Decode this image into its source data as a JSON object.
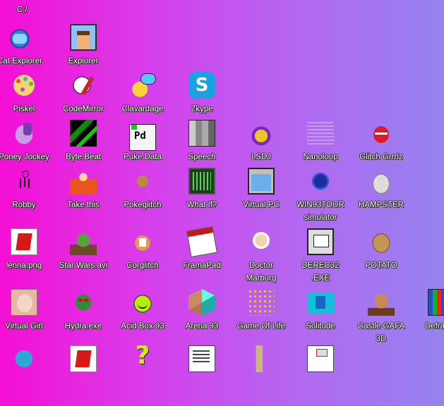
{
  "desktop": {
    "drive_label": "C:/",
    "icons": [
      {
        "label": "Cat Explorer",
        "icon": "cat-icon"
      },
      {
        "label": "Explorer",
        "icon": "explorer-window-icon"
      },
      {
        "label": "Piskel",
        "icon": "paint-palette-icon"
      },
      {
        "label": "CodeMirror",
        "icon": "codemirror-icon"
      },
      {
        "label": "Clavardage",
        "icon": "chat-smiley-icon"
      },
      {
        "label": "Zkype",
        "icon": "skype-icon"
      },
      {
        "label": "Poney Jockey",
        "icon": "pony-icon"
      },
      {
        "label": "Byte Beat",
        "icon": "bytebeat-icon"
      },
      {
        "label": "Puke Data",
        "icon": "puredata-icon"
      },
      {
        "label": "Speech",
        "icon": "speech-face-icon"
      },
      {
        "label": "LSDJ",
        "icon": "gameboy-icon"
      },
      {
        "label": "Nanoloop",
        "icon": "nanoloop-icon"
      },
      {
        "label": "Glitch Grrrlz",
        "icon": "lips-icon"
      },
      {
        "label": "Robby",
        "icon": "stick-figure-icon"
      },
      {
        "label": "Take this",
        "icon": "character-icon"
      },
      {
        "label": "Pokeglitch",
        "icon": "pokeglitch-icon"
      },
      {
        "label": "What If?",
        "icon": "terminal-icon"
      },
      {
        "label": "Virtual PC",
        "icon": "window-cursor-icon"
      },
      {
        "label": "WIN93TOUR\nsimulator",
        "icon": "blue-blob-icon"
      },
      {
        "label": "HAMPSTER",
        "icon": "hamster-icon"
      },
      {
        "label": "lenna.png",
        "icon": "image-file-icon"
      },
      {
        "label": "Star Wars.avi",
        "icon": "yoda-icon"
      },
      {
        "label": "Corglitch",
        "icon": "corgi-icon"
      },
      {
        "label": "FramaPad",
        "icon": "notepad-pencil-icon"
      },
      {
        "label": "Doctor\nMarburg",
        "icon": "doctor-icon"
      },
      {
        "label": "DEREC32\n.EXE",
        "icon": "computer-face-icon"
      },
      {
        "label": "POTATO",
        "icon": "potato-icon"
      },
      {
        "label": "Virtual Girl",
        "icon": "girl-face-icon"
      },
      {
        "label": "Hydra.exe",
        "icon": "dragon-icon"
      },
      {
        "label": "Acid Box 93",
        "icon": "acid-smiley-icon"
      },
      {
        "label": "Arena 93",
        "icon": "cube-icon"
      },
      {
        "label": "Game Of Life",
        "icon": "cells-icon"
      },
      {
        "label": "Solitude",
        "icon": "cards-icon"
      },
      {
        "label": "Castle GAFA\n3D",
        "icon": "doom-guy-icon"
      },
      {
        "label": "Defra",
        "icon": "defrag-icon"
      },
      {
        "label": "",
        "icon": "dolphin-icon"
      },
      {
        "label": "",
        "icon": "image-file-icon"
      },
      {
        "label": "",
        "icon": "question-mark-icon"
      },
      {
        "label": "",
        "icon": "notepad-icon"
      },
      {
        "label": "",
        "icon": "speaker-icon"
      },
      {
        "label": "",
        "icon": "mail-icon"
      }
    ]
  }
}
